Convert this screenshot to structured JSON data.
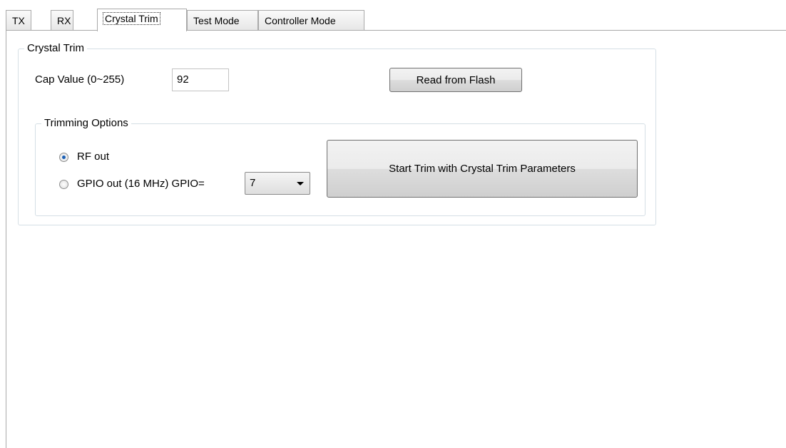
{
  "tabs": [
    {
      "label": "TX"
    },
    {
      "label": "RX"
    },
    {
      "label": "Crystal Trim",
      "active": true
    },
    {
      "label": "Test Mode"
    },
    {
      "label": "Controller Mode"
    }
  ],
  "crystal_trim": {
    "group_title": "Crystal Trim",
    "cap_label": "Cap Value (0~255)",
    "cap_value": "92",
    "read_button": "Read from Flash",
    "options": {
      "group_title": "Trimming Options",
      "rf_out_label": "RF out",
      "rf_out_checked": true,
      "gpio_out_label": "GPIO out (16 MHz) GPIO=",
      "gpio_out_checked": false,
      "gpio_value": "7",
      "start_button": "Start Trim with Crystal Trim Parameters"
    }
  },
  "colors": {
    "border": "#a9a9a9",
    "group_border": "#d5dfe5",
    "radio_dot": "#1a5fb4"
  }
}
